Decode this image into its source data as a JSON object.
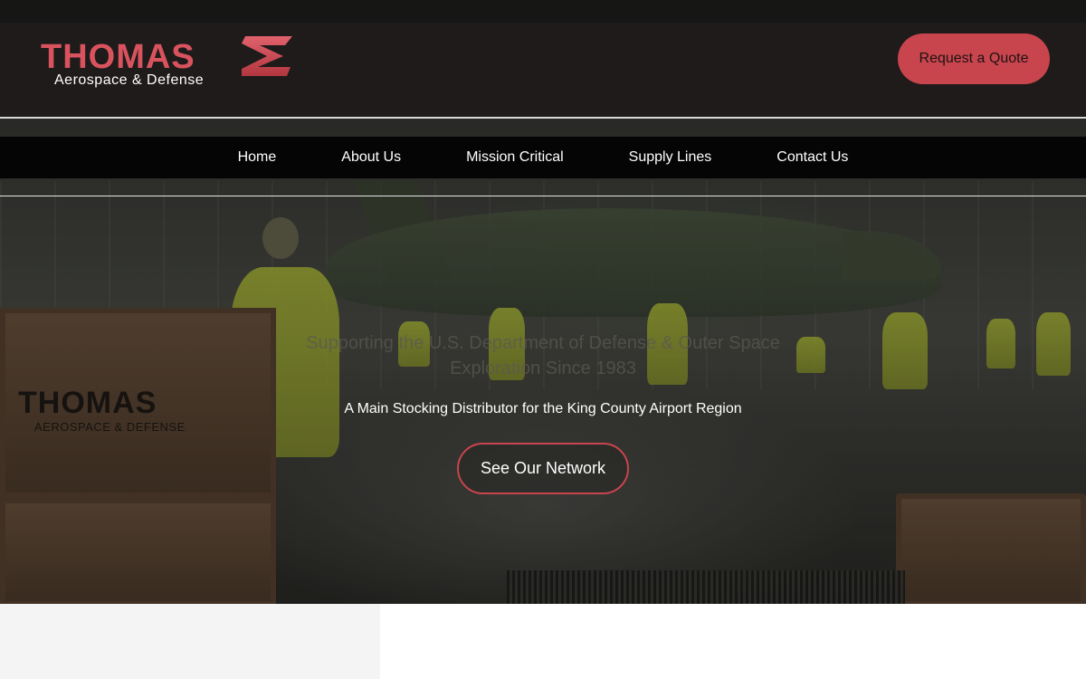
{
  "header": {
    "logo_word": "THOMAS",
    "logo_sub": "Aerospace & Defense",
    "quote_button": "Request a Quote"
  },
  "nav": {
    "items": [
      "Home",
      "About Us",
      "Mission Critical",
      "Supply Lines",
      "Contact Us"
    ]
  },
  "hero": {
    "ghost_headline": "Supporting the U.S. Department of Defense & Outer Space Exploration Since 1983",
    "tagline": "A Main Stocking Distributor for the King County Airport Region",
    "cta_button": "See Our Network",
    "crate_logo": "THOMAS",
    "crate_sub": "AEROSPACE & DEFENSE"
  },
  "colors": {
    "accent": "#c9454d",
    "header_bg": "#1e1b1a",
    "nav_bg": "#050505"
  }
}
